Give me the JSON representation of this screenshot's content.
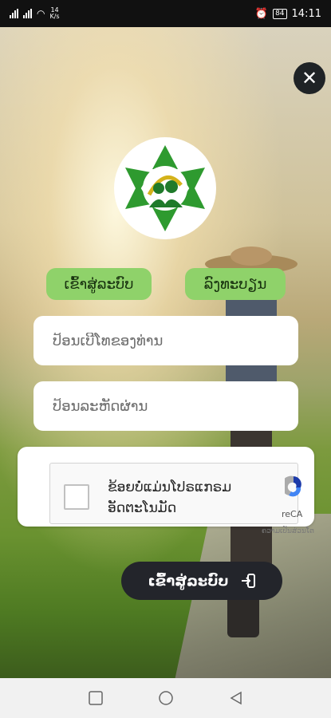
{
  "status_bar": {
    "network_type": "4G",
    "data_speed": "14\nK/s",
    "battery": "84",
    "time": "14:11"
  },
  "screen": {
    "tabs": {
      "login": "ເຂົ້າສູ່ລະບົບ",
      "register": "ລົງທະບຽນ"
    },
    "phone_placeholder": "ປ້ອນເບີໂທຂອງທ່ານ",
    "password_placeholder": "ປ້ອນລະຫັດຜ່ານ",
    "captcha": {
      "label": "ຂ້ອຍບໍ່ແມ່ນໂປຣແກຣມອັດຕະໂນມັດ",
      "brand": "reCA",
      "privacy": "ຄວາມເປັນສ່ວນໂຕ"
    },
    "submit_label": "ເຂົ້າສູ່ລະບົບ"
  },
  "colors": {
    "accent_green": "#8fd26a",
    "dark_button": "#23252b"
  },
  "icons": [
    "close-icon",
    "app-logo",
    "enter-icon",
    "recaptcha-icon",
    "nav-square-icon",
    "nav-circle-icon",
    "nav-back-icon"
  ]
}
